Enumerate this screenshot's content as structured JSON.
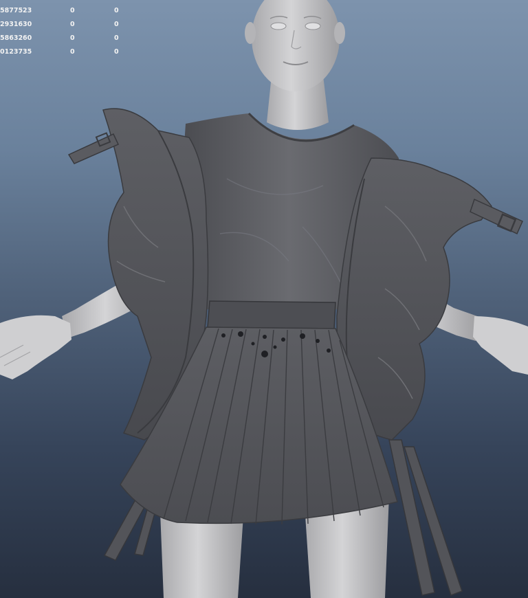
{
  "hud_rows": [
    {
      "id": "5877523",
      "c1": "0",
      "c2": "0"
    },
    {
      "id": "2931630",
      "c1": "0",
      "c2": "0"
    },
    {
      "id": "5863260",
      "c1": "0",
      "c2": "0"
    },
    {
      "id": "0123735",
      "c1": "0",
      "c2": "0"
    }
  ],
  "colors": {
    "viewport_top": "#7d93ad",
    "viewport_bottom": "#262f3f",
    "skin": "#c9c9cb",
    "cloth": "#5b5c61",
    "cloth_dark": "#3c3d41",
    "hud_text": "#f2f2f2"
  }
}
